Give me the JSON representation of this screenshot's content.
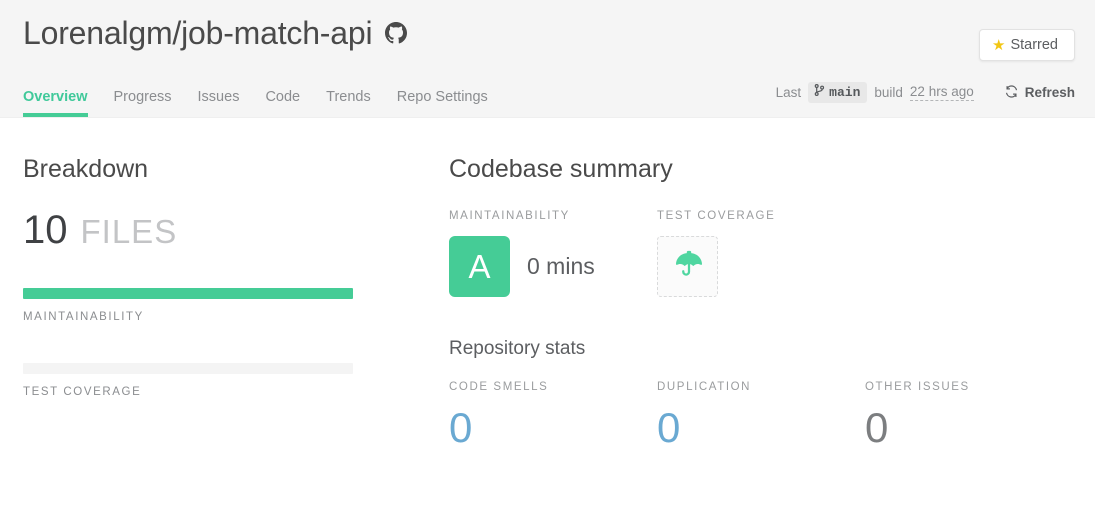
{
  "header": {
    "repo_title": "Lorenalgm/job-match-api",
    "github_icon": "github-icon",
    "tabs": [
      {
        "label": "Overview",
        "active": true
      },
      {
        "label": "Progress",
        "active": false
      },
      {
        "label": "Issues",
        "active": false
      },
      {
        "label": "Code",
        "active": false
      },
      {
        "label": "Trends",
        "active": false
      },
      {
        "label": "Repo Settings",
        "active": false
      }
    ],
    "starred_button": {
      "label": "Starred",
      "icon": "star-icon",
      "star_color": "#f2c614"
    },
    "build_info": {
      "prefix": "Last",
      "branch_icon": "git-branch-icon",
      "branch": "main",
      "middle": "build",
      "time_ago": "22 hrs ago"
    },
    "refresh_button": {
      "label": "Refresh",
      "icon": "refresh-icon"
    }
  },
  "breakdown": {
    "heading": "Breakdown",
    "files_count": "10",
    "files_label": "FILES",
    "bars": [
      {
        "label": "MAINTAINABILITY",
        "percent": 100,
        "color": "#45cc96"
      },
      {
        "label": "TEST COVERAGE",
        "percent": 0,
        "color": "#f4f4f4"
      }
    ]
  },
  "codebase_summary": {
    "heading": "Codebase summary",
    "maintainability": {
      "label": "MAINTAINABILITY",
      "grade": "A",
      "time": "0 mins",
      "grade_color": "#45cc96"
    },
    "test_coverage": {
      "label": "TEST COVERAGE",
      "icon": "umbrella-icon",
      "icon_color": "#4fd6a0"
    }
  },
  "repository_stats": {
    "heading": "Repository stats",
    "items": [
      {
        "label": "CODE SMELLS",
        "value": "0",
        "color": "#6aa9d2"
      },
      {
        "label": "DUPLICATION",
        "value": "0",
        "color": "#6aa9d2"
      },
      {
        "label": "OTHER ISSUES",
        "value": "0",
        "color": "#7c7e80"
      }
    ]
  }
}
